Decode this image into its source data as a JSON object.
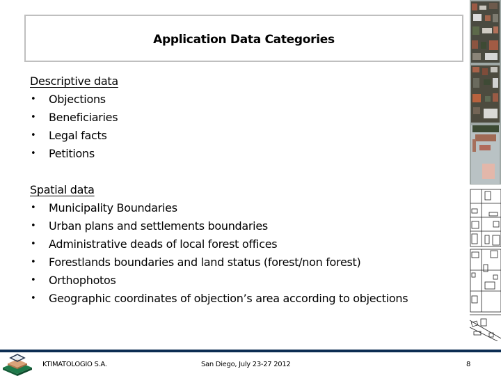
{
  "slide": {
    "title": "Application Data Categories",
    "sections": [
      {
        "heading": "Descriptive data",
        "items": [
          "Objections",
          "Beneficiaries",
          "Legal facts",
          "Petitions"
        ]
      },
      {
        "heading": "Spatial data",
        "items": [
          "Municipality Boundaries",
          "Urban plans and settlements boundaries",
          "Administrative deads of local forest offices",
          "Forestlands boundaries and land status (forest/non forest)",
          "Orthophotos",
          "Geographic coordinates of objection’s area according to objections"
        ]
      }
    ],
    "bullet_glyph": "•"
  },
  "side_images": {
    "orthophoto_icon": "orthophoto-aerial-image",
    "cadastral_icon": "cadastral-parcel-drawing"
  },
  "footer": {
    "logo_icon": "ktimatologio-logo",
    "organization": "KTIMATOLOGIO S.A.",
    "event": "San Diego, July 23-27 2012",
    "page_number": "8",
    "bar_color": "#0c2d52"
  }
}
